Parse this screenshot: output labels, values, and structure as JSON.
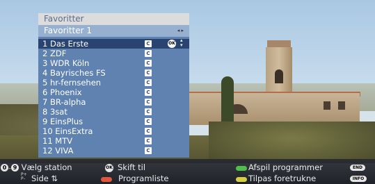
{
  "menu": {
    "title": "Favoritter",
    "subtitle": "Favoritter 1",
    "subtitle_arrows": "◂ ▸",
    "selected_index": 0,
    "channels": [
      {
        "label": "1 Das Erste"
      },
      {
        "label": "2 ZDF"
      },
      {
        "label": "3 WDR Köln"
      },
      {
        "label": "4 Bayrisches FS"
      },
      {
        "label": "5 hr-fernsehen"
      },
      {
        "label": "6 Phoenix"
      },
      {
        "label": "7 BR-alpha"
      },
      {
        "label": "8 3sat"
      },
      {
        "label": "9 EinsPlus"
      },
      {
        "label": "10 EinsExtra"
      },
      {
        "label": "11 MTV"
      },
      {
        "label": "12 VIVA"
      }
    ],
    "channel_badge": "C",
    "ok_badge": "OK"
  },
  "help": {
    "key_0": "0",
    "key_9": "9",
    "dash": "–",
    "select_station": "Vælg station",
    "ok_key": "OK",
    "switch_to": "Skift til",
    "play_programs": "Afspil programmer",
    "end_key": "END",
    "page_key": "P+\nP–",
    "page_label": "Side ⇅",
    "program_list": "Programliste",
    "adjust_favorites": "Tilpas foretrukne",
    "info_key": "INFO"
  },
  "colors": {
    "red": "#e2573c",
    "green": "#4fbf4a",
    "yellow": "#d6cf43",
    "selected_row": "#2a4471",
    "list_bg": "#5f82b0"
  }
}
